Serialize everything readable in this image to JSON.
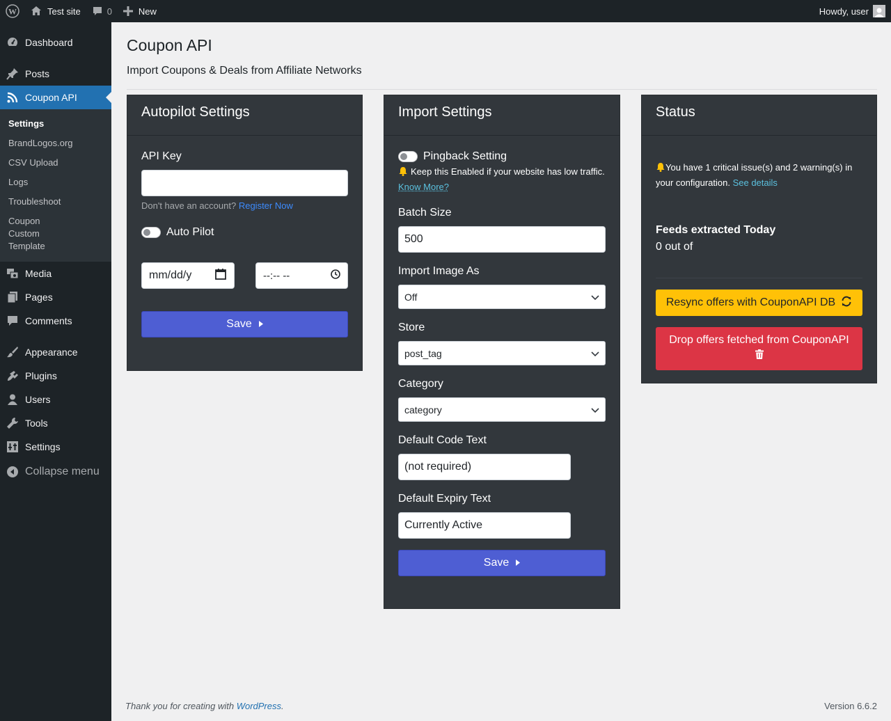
{
  "adminbar": {
    "site_name": "Test site",
    "comments_count": "0",
    "new_label": "New",
    "howdy": "Howdy, user"
  },
  "sidebar": {
    "items": [
      {
        "label": "Dashboard",
        "icon": "dashboard-icon"
      },
      {
        "label": "Posts",
        "icon": "pin-icon"
      },
      {
        "label": "Coupon API",
        "icon": "rss-icon"
      },
      {
        "label": "Media",
        "icon": "media-icon"
      },
      {
        "label": "Pages",
        "icon": "pages-icon"
      },
      {
        "label": "Comments",
        "icon": "comment-icon"
      },
      {
        "label": "Appearance",
        "icon": "brush-icon"
      },
      {
        "label": "Plugins",
        "icon": "plugin-icon"
      },
      {
        "label": "Users",
        "icon": "user-icon"
      },
      {
        "label": "Tools",
        "icon": "wrench-icon"
      },
      {
        "label": "Settings",
        "icon": "settings-icon"
      }
    ],
    "submenu": [
      "Settings",
      "BrandLogos.org",
      "CSV Upload",
      "Logs",
      "Troubleshoot",
      "Coupon Custom Template"
    ],
    "collapse": "Collapse menu"
  },
  "page": {
    "title": "Coupon API",
    "subtitle": "Import Coupons & Deals from Affiliate Networks"
  },
  "autopilot": {
    "title": "Autopilot Settings",
    "api_key_label": "API Key",
    "api_key_value": "",
    "no_account": "Don't have an account?",
    "register": "Register Now",
    "auto_pilot_label": "Auto Pilot",
    "date_placeholder": "mm/dd/y",
    "time_placeholder": "--:-- --",
    "save": "Save"
  },
  "import": {
    "title": "Import Settings",
    "pingback_label": "Pingback Setting",
    "pingback_note": "Keep this Enabled if your website has low traffic.",
    "know_more": "Know More?",
    "batch_label": "Batch Size",
    "batch_value": "500",
    "image_label": "Import Image As",
    "image_value": "Off",
    "store_label": "Store",
    "store_value": "post_tag",
    "category_label": "Category",
    "category_value": "category",
    "code_label": "Default Code Text",
    "code_value": "(not required)",
    "expiry_label": "Default Expiry Text",
    "expiry_value": "Currently Active",
    "save": "Save"
  },
  "status": {
    "title": "Status",
    "issue_text": "You have 1 critical issue(s) and 2 warning(s) in your configuration.",
    "see_details": "See details",
    "feeds_title": "Feeds extracted Today",
    "feeds_value": "0 out of",
    "resync": "Resync offers with CouponAPI DB",
    "drop": "Drop offers fetched from CouponAPI"
  },
  "footer": {
    "thanks": "Thank you for creating with",
    "wordpress": "WordPress",
    "version": "Version 6.6.2"
  }
}
